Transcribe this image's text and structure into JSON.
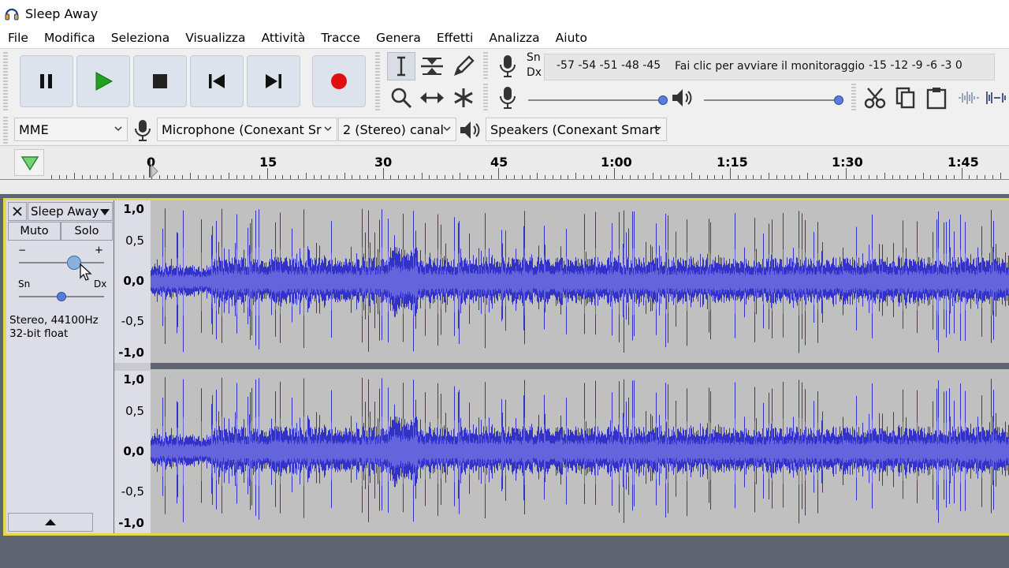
{
  "window": {
    "title": "Sleep Away"
  },
  "menu": [
    "File",
    "Modifica",
    "Seleziona",
    "Visualizza",
    "Attività",
    "Tracce",
    "Genera",
    "Effetti",
    "Analizza",
    "Aiuto"
  ],
  "transport": {
    "buttons": [
      {
        "name": "pause-button",
        "icon": "pause-icon"
      },
      {
        "name": "play-button",
        "icon": "play-icon"
      },
      {
        "name": "stop-button",
        "icon": "stop-icon"
      },
      {
        "name": "skip-start-button",
        "icon": "skip-start-icon"
      },
      {
        "name": "skip-end-button",
        "icon": "skip-end-icon"
      },
      {
        "name": "record-button",
        "icon": "record-icon"
      }
    ]
  },
  "meter": {
    "left_label": "Sn",
    "right_label": "Dx",
    "scale_left": "-57 -54 -51 -48 -45",
    "monitor_prompt": "Fai clic per avviare il monitoraggio",
    "scale_right": "-15 -12 -9 -6 -3 0"
  },
  "device": {
    "host": "MME",
    "input": "Microphone (Conexant Sr",
    "channels": "2 (Stereo) canal",
    "output": "Speakers (Conexant Smart"
  },
  "timeline": {
    "labels": [
      "0",
      "15",
      "30",
      "45",
      "1:00",
      "1:15",
      "1:30",
      "1:45"
    ]
  },
  "track": {
    "name": "Sleep Away",
    "mute_label": "Muto",
    "solo_label": "Solo",
    "gain_minus": "−",
    "gain_plus": "+",
    "gain_level": 0.65,
    "pan_left": "Sn",
    "pan_right": "Dx",
    "pan_level": 0.5,
    "info_line1": "Stereo, 44100Hz",
    "info_line2": "32-bit float"
  },
  "vertical_ruler": [
    "1,0",
    "0,5",
    "0,0",
    "-0,5",
    "-1,0"
  ],
  "colors": {
    "waveform": "#3232c8",
    "waveform_light": "#6464dc",
    "record": "#e01010",
    "play": "#22a022",
    "selection_border": "#e2d94a"
  }
}
